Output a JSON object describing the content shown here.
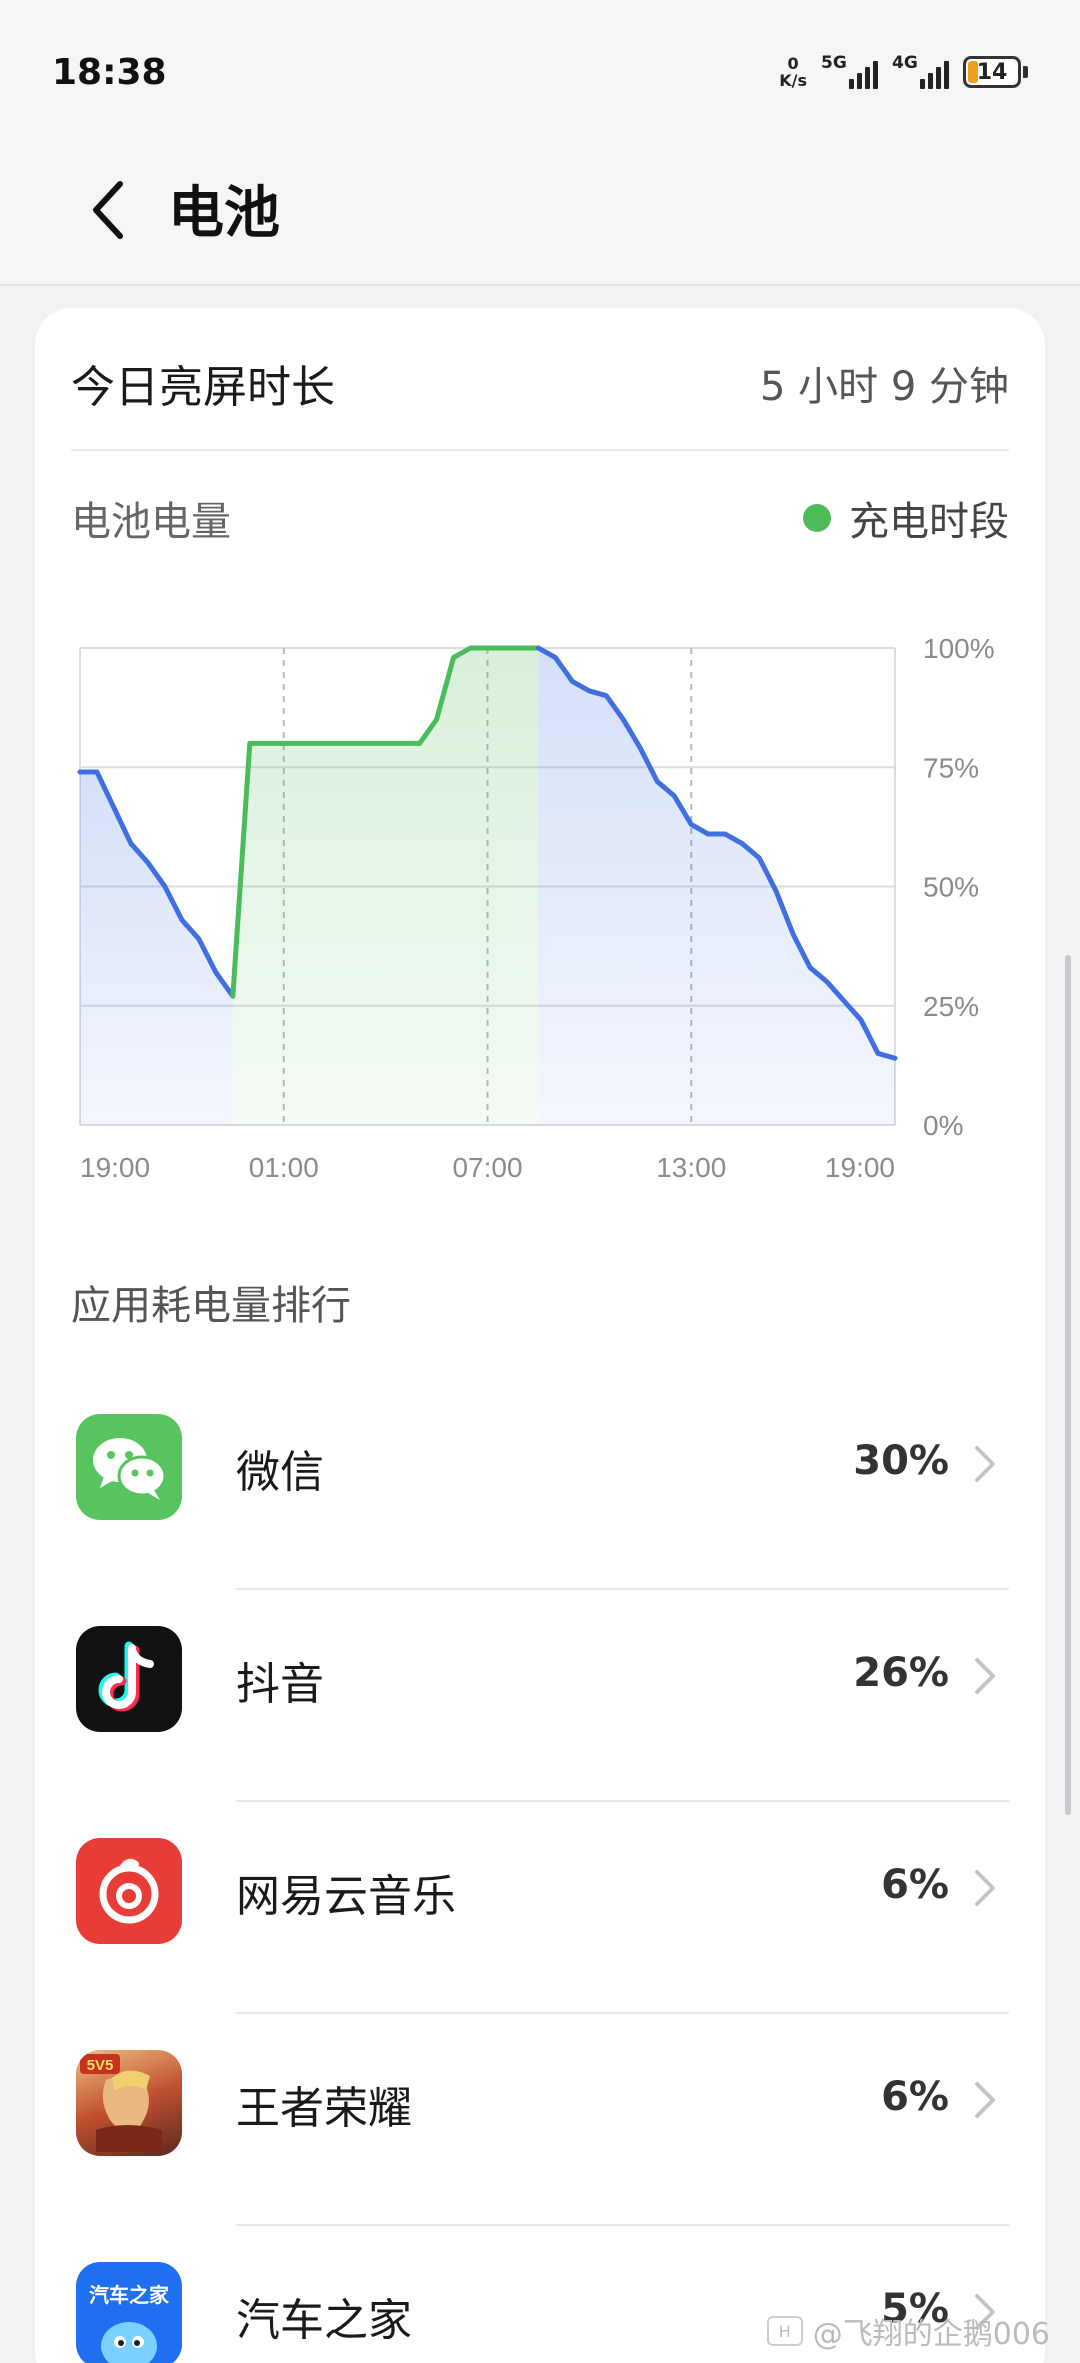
{
  "status_bar": {
    "time": "18:38",
    "net_speed_value": "0",
    "net_speed_unit": "K/s",
    "sim1": "5G",
    "sim2": "4G",
    "battery_level": "14"
  },
  "header": {
    "title": "电池",
    "back_icon": "chevron-left-icon"
  },
  "screen_time": {
    "label": "今日亮屏时长",
    "value": "5 小时 9 分钟"
  },
  "battery_section": {
    "label": "电池电量",
    "legend": "充电时段",
    "legend_color": "#4cbb5a"
  },
  "chart_data": {
    "type": "line",
    "x_tick_labels": [
      "19:00",
      "01:00",
      "07:00",
      "13:00",
      "19:00"
    ],
    "y_tick_labels": [
      "100%",
      "75%",
      "50%",
      "25%",
      "0%"
    ],
    "ylim": [
      0,
      100
    ],
    "x_unit": "hours since 19:00 previous day",
    "series": [
      {
        "name": "电池电量",
        "color": "#3f6fe0",
        "x": [
          0,
          0.5,
          1.5,
          2,
          2.5,
          3,
          3.5,
          4,
          4.5
        ],
        "y": [
          74,
          74,
          59,
          55,
          50,
          43,
          39,
          32,
          27
        ]
      },
      {
        "name": "充电时段",
        "color": "#4cbb5a",
        "x": [
          4.5,
          5,
          10,
          10.5,
          11,
          11.5,
          12,
          12.5,
          13.5
        ],
        "y": [
          27,
          80,
          80,
          85,
          98,
          100,
          100,
          100,
          100
        ]
      },
      {
        "name": "电池电量",
        "color": "#3f6fe0",
        "x": [
          13.5,
          14,
          14.5,
          15,
          15.5,
          16,
          16.5,
          17,
          17.5,
          18,
          18.5,
          19,
          19.5,
          20,
          20.5,
          21,
          21.5,
          22,
          22.5,
          23,
          23.5,
          24
        ],
        "y": [
          100,
          98,
          93,
          91,
          90,
          85,
          79,
          72,
          69,
          63,
          61,
          61,
          59,
          56,
          49,
          40,
          33,
          30,
          26,
          22,
          15,
          14
        ]
      }
    ],
    "charging_range": [
      4.5,
      13.5
    ],
    "grid": true
  },
  "ranking": {
    "title": "应用耗电量排行",
    "apps": [
      {
        "name": "微信",
        "percent": "30%"
      },
      {
        "name": "抖音",
        "percent": "26%"
      },
      {
        "name": "网易云音乐",
        "percent": "6%"
      },
      {
        "name": "王者荣耀",
        "percent": "6%"
      },
      {
        "name": "汽车之家",
        "percent": "5%"
      }
    ]
  },
  "icon_texts": {
    "honor_of_kings": "5V5",
    "autohome": "汽车之家"
  },
  "watermark": {
    "text": "@飞翔的企鹅006"
  }
}
